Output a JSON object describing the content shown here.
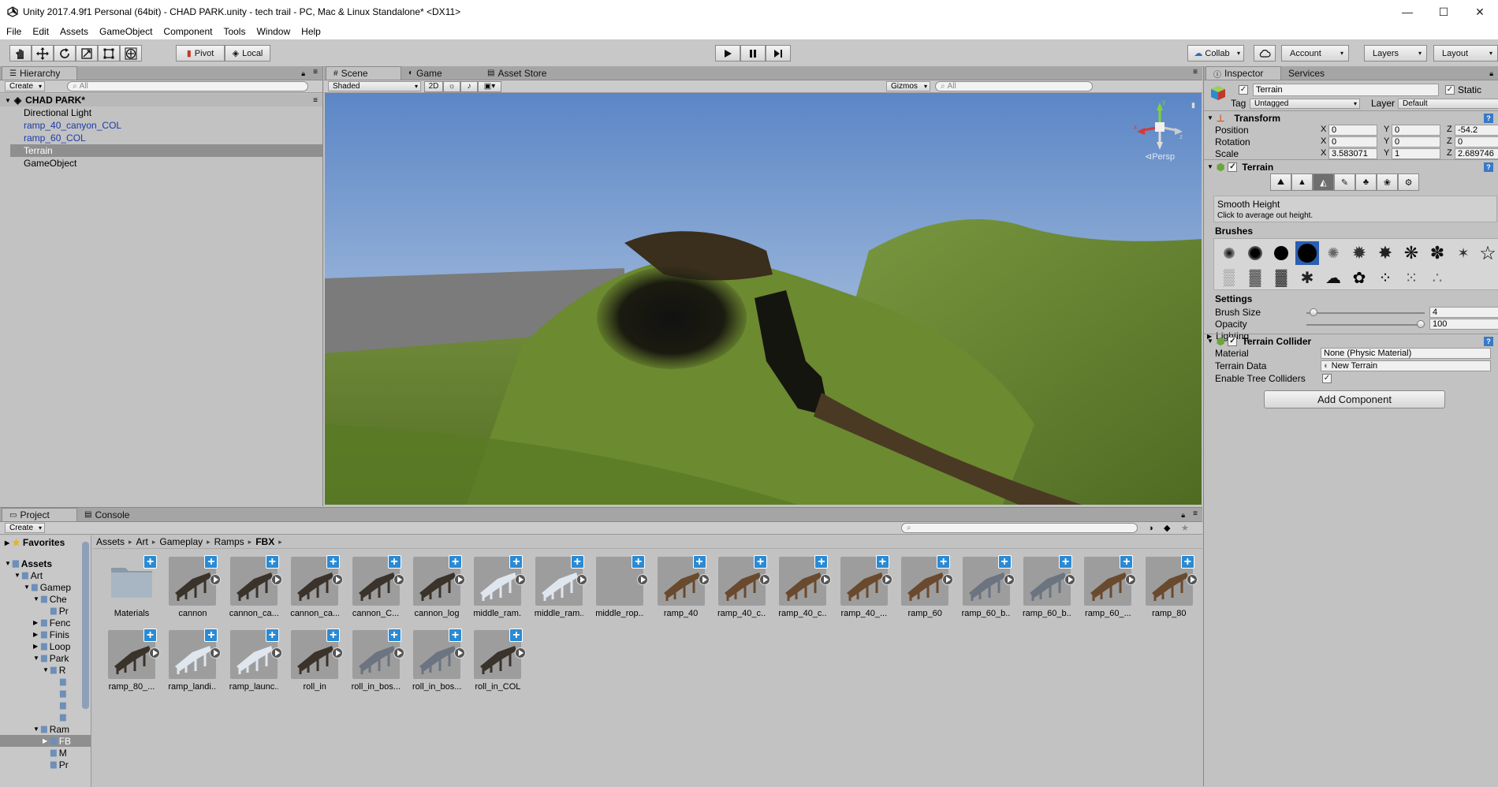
{
  "window": {
    "title": "Unity 2017.4.9f1 Personal (64bit) - CHAD PARK.unity - tech trail - PC, Mac & Linux Standalone* <DX11>",
    "minimize": "—",
    "maximize": "☐",
    "close": "✕"
  },
  "menu": [
    "File",
    "Edit",
    "Assets",
    "GameObject",
    "Component",
    "Tools",
    "Window",
    "Help"
  ],
  "toolbar": {
    "tools": [
      "hand-tool-icon",
      "move-tool-icon",
      "rotate-tool-icon",
      "scale-tool-icon",
      "rect-tool-icon",
      "transform-tool-icon"
    ],
    "pivot": "Pivot",
    "local": "Local",
    "collab": "Collab",
    "account": "Account",
    "layers": "Layers",
    "layout": "Layout"
  },
  "hierarchy": {
    "tab": "Hierarchy",
    "create": "Create",
    "search_placeholder": "All",
    "scene": "CHAD PARK*",
    "items": [
      {
        "label": "Directional Light",
        "prefab": false,
        "selected": false
      },
      {
        "label": "ramp_40_canyon_COL",
        "prefab": true,
        "selected": false
      },
      {
        "label": "ramp_60_COL",
        "prefab": true,
        "selected": false
      },
      {
        "label": "Terrain",
        "prefab": false,
        "selected": true
      },
      {
        "label": "GameObject",
        "prefab": false,
        "selected": false
      }
    ]
  },
  "scene": {
    "tabs": [
      "Scene",
      "Game",
      "Asset Store"
    ],
    "shading": "Shaded",
    "mode2d": "2D",
    "gizmos": "Gizmos",
    "search_placeholder": "All",
    "persp": "Persp",
    "gizmo_axes": [
      "y",
      "x",
      "z"
    ]
  },
  "inspector": {
    "tabs": [
      "Inspector",
      "Services"
    ],
    "object_name": "Terrain",
    "static_label": "Static",
    "tag_label": "Tag",
    "tag_value": "Untagged",
    "layer_label": "Layer",
    "layer_value": "Default",
    "transform": {
      "title": "Transform",
      "rows": [
        {
          "label": "Position",
          "x": "0",
          "y": "0",
          "z": "-54.2"
        },
        {
          "label": "Rotation",
          "x": "0",
          "y": "0",
          "z": "0"
        },
        {
          "label": "Scale",
          "x": "3.583071",
          "y": "1",
          "z": "2.689746"
        }
      ],
      "axis_x": "X",
      "axis_y": "Y",
      "axis_z": "Z"
    },
    "terrain": {
      "title": "Terrain",
      "tool_title": "Smooth Height",
      "tool_desc": "Click to average out height.",
      "brushes_label": "Brushes",
      "settings_label": "Settings",
      "brush_size_label": "Brush Size",
      "brush_size_value": "4",
      "brush_size_fraction": 0.03,
      "opacity_label": "Opacity",
      "opacity_value": "100",
      "opacity_fraction": 1.0,
      "lighting_label": "Lighting"
    },
    "collider": {
      "title": "Terrain Collider",
      "material_label": "Material",
      "material_value": "None (Physic Material)",
      "data_label": "Terrain Data",
      "data_value": "New Terrain",
      "trees_label": "Enable Tree Colliders"
    },
    "add_component": "Add Component"
  },
  "project": {
    "tabs": [
      "Project",
      "Console"
    ],
    "create": "Create",
    "favorites": "Favorites",
    "breadcrumb": [
      "Assets",
      "Art",
      "Gameplay",
      "Ramps",
      "FBX"
    ],
    "tree": [
      {
        "label": "Assets",
        "bold": true
      },
      {
        "label": "Art"
      },
      {
        "label": "Gamep"
      },
      {
        "label": "Che"
      },
      {
        "label": "Pr"
      },
      {
        "label": "Fenc"
      },
      {
        "label": "Finis"
      },
      {
        "label": "Loop"
      },
      {
        "label": "Park"
      },
      {
        "label": "R"
      },
      {
        "label": ""
      },
      {
        "label": ""
      },
      {
        "label": ""
      },
      {
        "label": ""
      },
      {
        "label": "Ram"
      },
      {
        "label": "FB"
      },
      {
        "label": "M"
      },
      {
        "label": "Pr"
      }
    ],
    "assets": [
      {
        "label": "Materials",
        "kind": "folder"
      },
      {
        "label": "cannon",
        "kind": "dark"
      },
      {
        "label": "cannon_ca...",
        "kind": "dark"
      },
      {
        "label": "cannon_ca...",
        "kind": "dark"
      },
      {
        "label": "cannon_C...",
        "kind": "dark"
      },
      {
        "label": "cannon_log",
        "kind": "dark"
      },
      {
        "label": "middle_ram...",
        "kind": "light"
      },
      {
        "label": "middle_ram...",
        "kind": "light"
      },
      {
        "label": "middle_rop...",
        "kind": "empty"
      },
      {
        "label": "ramp_40",
        "kind": "brown"
      },
      {
        "label": "ramp_40_c...",
        "kind": "brown"
      },
      {
        "label": "ramp_40_c...",
        "kind": "brown"
      },
      {
        "label": "ramp_40_...",
        "kind": "brown"
      },
      {
        "label": "ramp_60",
        "kind": "brown"
      },
      {
        "label": "ramp_60_b...",
        "kind": "grey"
      },
      {
        "label": "ramp_60_b...",
        "kind": "grey"
      },
      {
        "label": "ramp_60_...",
        "kind": "brown"
      },
      {
        "label": "ramp_80",
        "kind": "brown"
      },
      {
        "label": "ramp_80_...",
        "kind": "dark"
      },
      {
        "label": "ramp_landi...",
        "kind": "light"
      },
      {
        "label": "ramp_launc...",
        "kind": "light"
      },
      {
        "label": "roll_in",
        "kind": "dark"
      },
      {
        "label": "roll_in_bos...",
        "kind": "grey"
      },
      {
        "label": "roll_in_bos...",
        "kind": "grey"
      },
      {
        "label": "roll_in_COL",
        "kind": "dark"
      }
    ]
  },
  "colors": {
    "sky_top": "#5b86c6",
    "sky_bottom": "#c8d8ea",
    "grass": "#5f7a2d",
    "accent_blue": "#2a8ad4",
    "selection": "#8f8f8f"
  }
}
